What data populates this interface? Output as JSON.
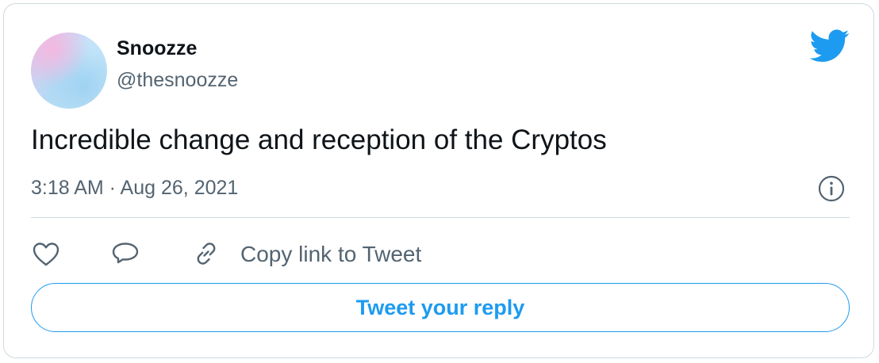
{
  "author": {
    "display_name": "Snoozze",
    "handle": "@thesnoozze"
  },
  "tweet": {
    "text": "Incredible change and reception of the Cryptos",
    "timestamp": "3:18 AM · Aug 26, 2021"
  },
  "actions": {
    "like_icon": "heart-icon",
    "reply_icon": "speech-bubble-icon",
    "copy_icon": "link-icon",
    "copy_label": "Copy link to Tweet"
  },
  "reply_button": {
    "label": "Tweet your reply"
  },
  "icons": {
    "brand": "twitter-bird-icon",
    "info": "info-icon"
  },
  "colors": {
    "accent": "#1d9bf0",
    "text": "#0f1419",
    "muted": "#536471",
    "border": "#cfd9de"
  }
}
